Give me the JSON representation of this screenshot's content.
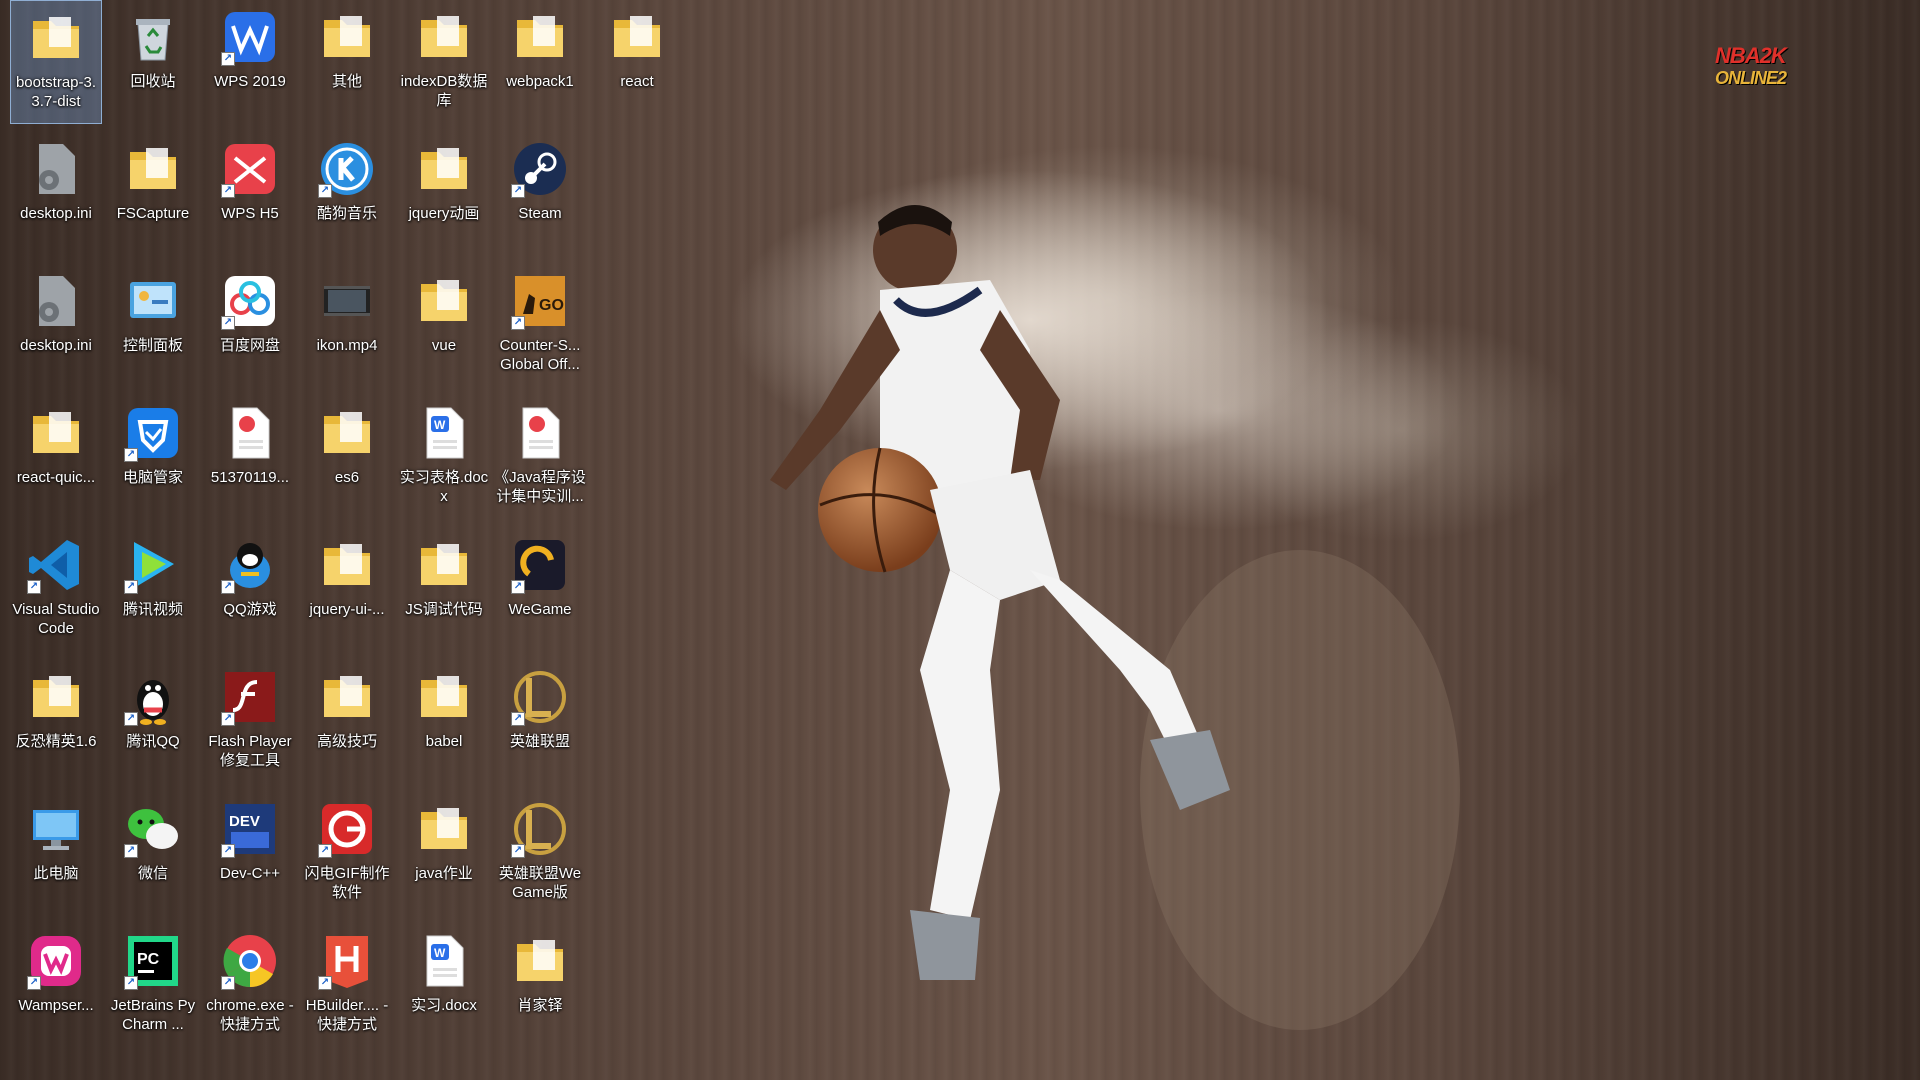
{
  "logo": {
    "line1": "NBA2K",
    "line2": "ONLINE2"
  },
  "icons": [
    {
      "label": "bootstrap-3.3.7-dist",
      "icon": "folder-icon",
      "selected": true
    },
    {
      "label": "回收站",
      "icon": "recycle-bin-icon"
    },
    {
      "label": "WPS 2019",
      "icon": "wps-icon"
    },
    {
      "label": "其他",
      "icon": "folder-icon"
    },
    {
      "label": "indexDB数据库",
      "icon": "folder-icon"
    },
    {
      "label": "webpack1",
      "icon": "folder-icon"
    },
    {
      "label": "react",
      "icon": "folder-icon"
    },
    {
      "label": "desktop.ini",
      "icon": "settings-file-icon"
    },
    {
      "label": "FSCapture",
      "icon": "folder-icon"
    },
    {
      "label": "WPS H5",
      "icon": "wps-h5-icon"
    },
    {
      "label": "酷狗音乐",
      "icon": "kugou-icon"
    },
    {
      "label": "jquery动画",
      "icon": "folder-icon"
    },
    {
      "label": "Steam",
      "icon": "steam-icon"
    },
    {
      "label": "desktop.ini",
      "icon": "settings-file-icon"
    },
    {
      "label": "控制面板",
      "icon": "control-panel-icon"
    },
    {
      "label": "百度网盘",
      "icon": "baidu-netdisk-icon"
    },
    {
      "label": "ikon.mp4",
      "icon": "video-file-icon"
    },
    {
      "label": "vue",
      "icon": "folder-icon"
    },
    {
      "label": "Counter-S... Global Off...",
      "icon": "csgo-icon"
    },
    {
      "label": "react-quic...",
      "icon": "folder-icon"
    },
    {
      "label": "电脑管家",
      "icon": "pc-manager-icon"
    },
    {
      "label": "51370119...",
      "icon": "pdf-file-icon"
    },
    {
      "label": "es6",
      "icon": "folder-icon"
    },
    {
      "label": "实习表格.docx",
      "icon": "word-file-icon"
    },
    {
      "label": "《Java程序设计集中实训...",
      "icon": "pdf-file-icon"
    },
    {
      "label": "Visual Studio Code",
      "icon": "vscode-icon"
    },
    {
      "label": "腾讯视频",
      "icon": "tencent-video-icon"
    },
    {
      "label": "QQ游戏",
      "icon": "qq-game-icon"
    },
    {
      "label": "jquery-ui-...",
      "icon": "folder-icon"
    },
    {
      "label": "JS调试代码",
      "icon": "folder-icon"
    },
    {
      "label": "WeGame",
      "icon": "wegame-icon"
    },
    {
      "label": "反恐精英1.6",
      "icon": "folder-icon"
    },
    {
      "label": "腾讯QQ",
      "icon": "qq-icon"
    },
    {
      "label": "Flash Player修复工具",
      "icon": "flash-icon"
    },
    {
      "label": "高级技巧",
      "icon": "folder-icon"
    },
    {
      "label": "babel",
      "icon": "folder-icon"
    },
    {
      "label": "英雄联盟",
      "icon": "lol-icon"
    },
    {
      "label": "此电脑",
      "icon": "this-pc-icon"
    },
    {
      "label": "微信",
      "icon": "wechat-icon"
    },
    {
      "label": "Dev-C++",
      "icon": "devcpp-icon"
    },
    {
      "label": "闪电GIF制作软件",
      "icon": "gif-maker-icon"
    },
    {
      "label": "java作业",
      "icon": "folder-icon"
    },
    {
      "label": "英雄联盟WeGame版",
      "icon": "lol-icon"
    },
    {
      "label": "Wampser...",
      "icon": "wampserver-icon"
    },
    {
      "label": "JetBrains PyCharm ...",
      "icon": "pycharm-icon"
    },
    {
      "label": "chrome.exe - 快捷方式",
      "icon": "chrome-icon"
    },
    {
      "label": "HBuilder.... - 快捷方式",
      "icon": "hbuilder-icon"
    },
    {
      "label": "实习.docx",
      "icon": "word-file-icon"
    },
    {
      "label": "肖家铎",
      "icon": "folder-icon"
    }
  ]
}
